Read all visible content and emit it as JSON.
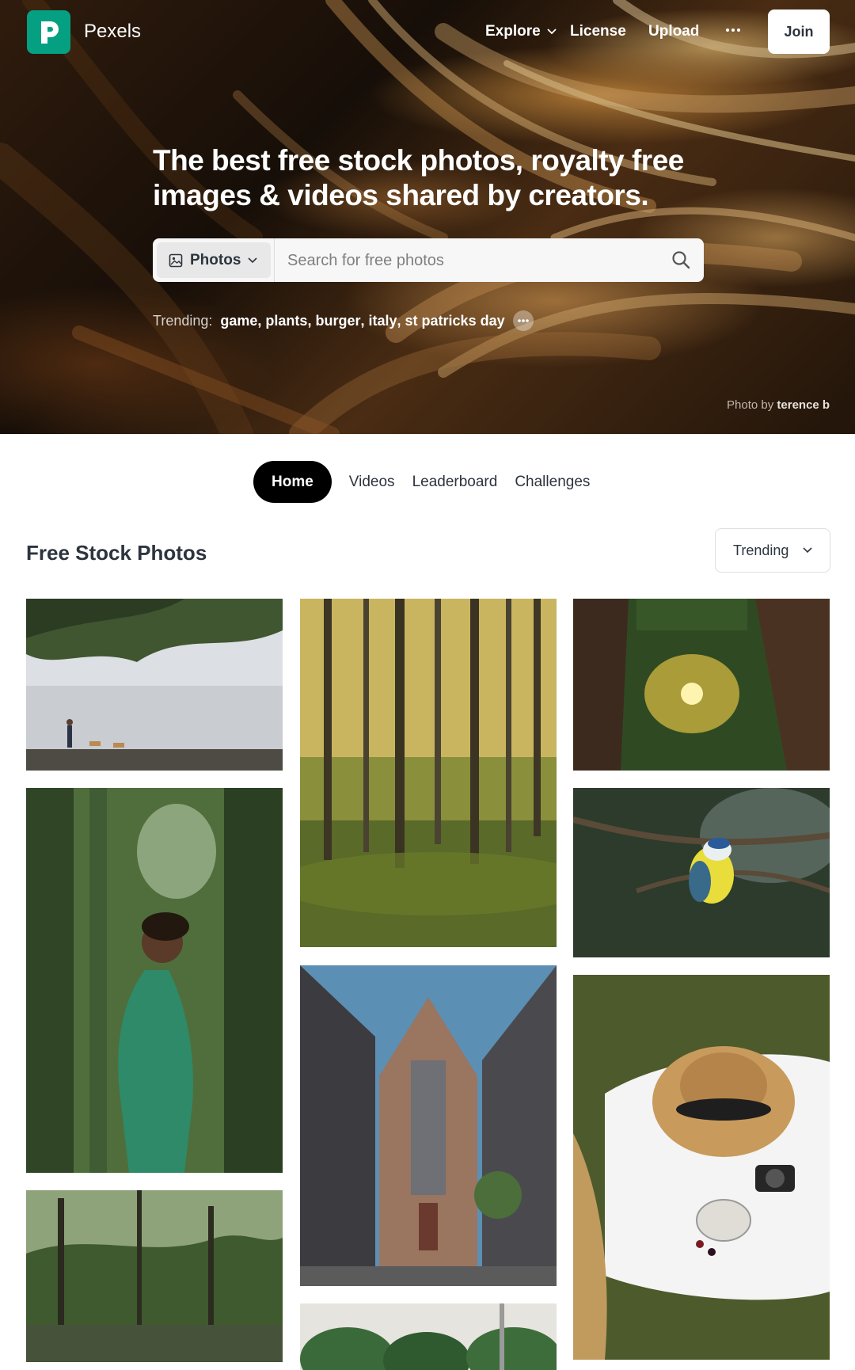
{
  "header": {
    "brand": "Pexels",
    "nav": {
      "explore": "Explore",
      "license": "License",
      "upload": "Upload",
      "join": "Join"
    }
  },
  "hero": {
    "headline": "The best free stock photos, royalty free images & videos shared by creators.",
    "search": {
      "type_label": "Photos",
      "placeholder": "Search for free photos"
    },
    "trending": {
      "label": "Trending:",
      "tags": [
        "game",
        "plants",
        "burger",
        "italy",
        "st patricks day"
      ]
    },
    "credit": {
      "prefix": "Photo by",
      "author": "terence b"
    }
  },
  "tabs": [
    "Home",
    "Videos",
    "Leaderboard",
    "Challenges"
  ],
  "feed": {
    "title": "Free Stock Photos",
    "sort_label": "Trending"
  },
  "colors": {
    "brand": "#05a081",
    "text": "#2c343e"
  }
}
